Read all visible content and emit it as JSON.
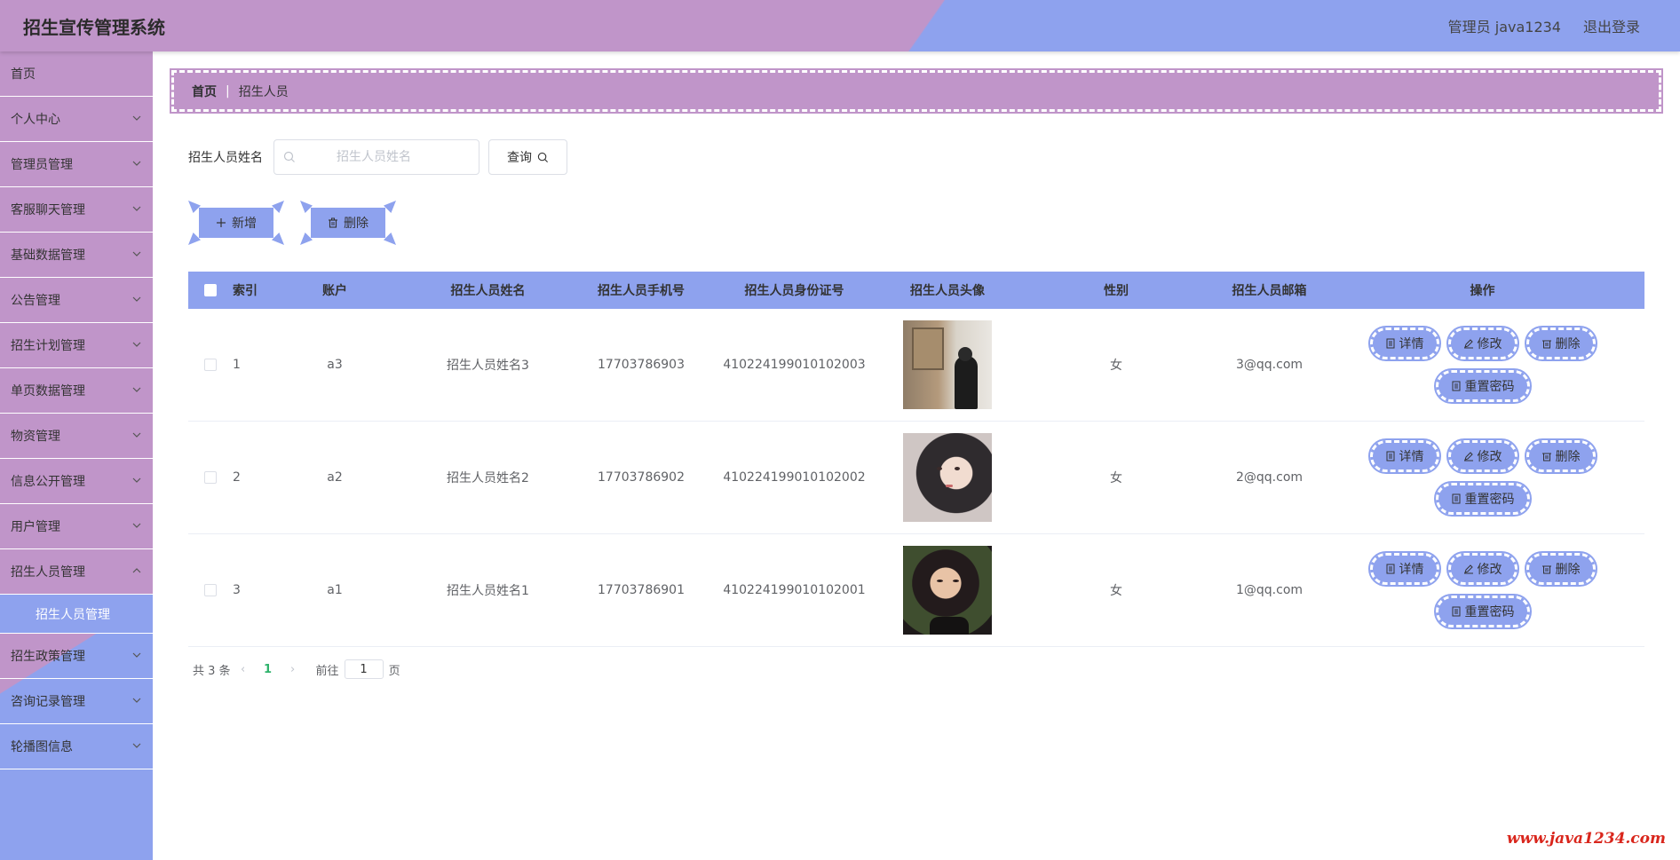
{
  "header": {
    "title": "招生宣传管理系统",
    "admin_label": "管理员 java1234",
    "logout_label": "退出登录"
  },
  "sidebar": {
    "items": [
      {
        "label": "首页"
      },
      {
        "label": "个人中心"
      },
      {
        "label": "管理员管理"
      },
      {
        "label": "客服聊天管理"
      },
      {
        "label": "基础数据管理"
      },
      {
        "label": "公告管理"
      },
      {
        "label": "招生计划管理"
      },
      {
        "label": "单页数据管理"
      },
      {
        "label": "物资管理"
      },
      {
        "label": "信息公开管理"
      },
      {
        "label": "用户管理"
      },
      {
        "label": "招生人员管理"
      },
      {
        "label": "招生政策管理"
      },
      {
        "label": "咨询记录管理"
      },
      {
        "label": "轮播图信息"
      }
    ],
    "active_sub": "招生人员管理"
  },
  "breadcrumb": {
    "home": "首页",
    "sep": "|",
    "current": "招生人员"
  },
  "search": {
    "label": "招生人员姓名",
    "placeholder": "招生人员姓名",
    "button": "查询"
  },
  "actions": {
    "add": "新增",
    "delete": "删除"
  },
  "table": {
    "columns": [
      "索引",
      "账户",
      "招生人员姓名",
      "招生人员手机号",
      "招生人员身份证号",
      "招生人员头像",
      "性别",
      "招生人员邮箱",
      "操作"
    ],
    "rows": [
      {
        "index": "1",
        "account": "a3",
        "name": "招生人员姓名3",
        "phone": "17703786903",
        "idcard": "410224199010102003",
        "sex": "女",
        "email": "3@qq.com"
      },
      {
        "index": "2",
        "account": "a2",
        "name": "招生人员姓名2",
        "phone": "17703786902",
        "idcard": "410224199010102002",
        "sex": "女",
        "email": "2@qq.com"
      },
      {
        "index": "3",
        "account": "a1",
        "name": "招生人员姓名1",
        "phone": "17703786901",
        "idcard": "410224199010102001",
        "sex": "女",
        "email": "1@qq.com"
      }
    ],
    "ops": {
      "detail": "详情",
      "edit": "修改",
      "delete": "删除",
      "reset": "重置密码"
    }
  },
  "pager": {
    "total": "共 3 条",
    "page": "1",
    "goto_prefix": "前往",
    "goto_value": "1",
    "goto_suffix": "页"
  },
  "watermark": "www.java1234.com",
  "colors": {
    "purple": "#c095c9",
    "blue": "#8ea2ee"
  }
}
